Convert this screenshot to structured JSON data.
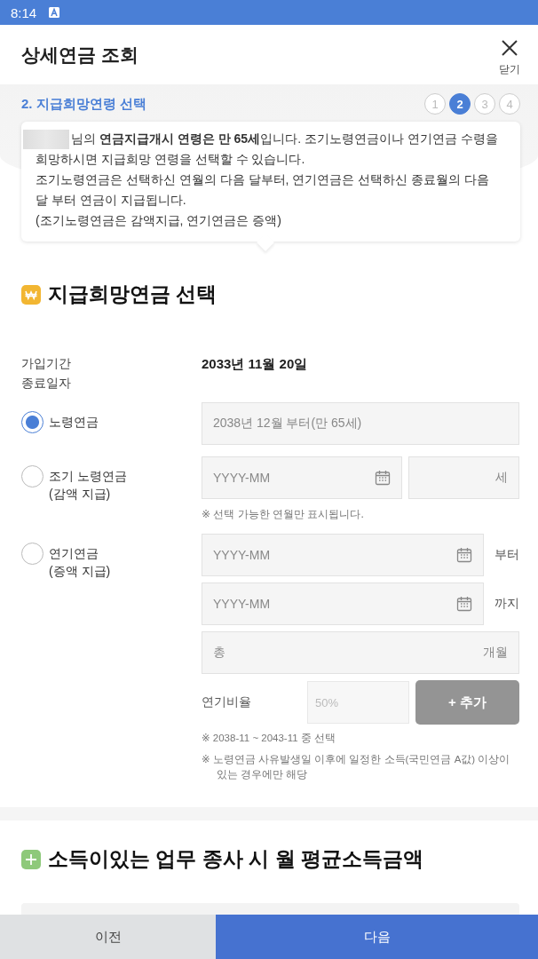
{
  "status_bar": {
    "time": "8:14"
  },
  "header": {
    "title": "상세연금 조회",
    "close_label": "닫기"
  },
  "steps": {
    "title": "2. 지급희망연령 선택",
    "items": [
      {
        "label": "1",
        "selected": false
      },
      {
        "label": "2",
        "selected": true
      },
      {
        "label": "3",
        "selected": false
      },
      {
        "label": "4",
        "selected": false
      }
    ]
  },
  "notice": {
    "paragraphs": [
      "님의 **연금지급개시 연령은 만 65세**입니다. 조기노령연금이나 연기연금 수령을 희망하시면 지급희망 연령을 선택할 수 있습니다.",
      "조기노령연금은 선택하신 연월의 다음 달부터, 연기연금은 선택하신 종료월의 다음 달 부터 연금이 지급됩니다.",
      "(조기노령연금은 감액지급, 연기연금은 증액)"
    ]
  },
  "section1": {
    "title": "지급희망연금 선택",
    "end_date_label": [
      "가입기간",
      "종료일자"
    ],
    "end_date": "2033년 11월 20일",
    "options": [
      {
        "kind": "fixed",
        "label": "노령연금",
        "selected": true,
        "value": "2038년 12월 부터(만 65세)"
      },
      {
        "kind": "early",
        "label": "조기 노령연금",
        "sublabel": "(감액 지급)",
        "selected": false,
        "date_placeholder": "YYYY-MM",
        "age_unit": "세",
        "note": "※ 선택 가능한 연월만 표시됩니다."
      },
      {
        "kind": "deferred",
        "label": "연기연금",
        "sublabel": "(증액 지급)",
        "selected": false,
        "from_placeholder": "YYYY-MM",
        "from_suffix": "부터",
        "to_placeholder": "YYYY-MM",
        "to_suffix": "까지",
        "total_prefix": "총",
        "total_unit": "개월",
        "ratio_label": "연기비율",
        "ratio_placeholder": "50%",
        "add_button": "+ 추가",
        "add_disabled": true,
        "notes": [
          "※ 2038-11 ~ 2043-11 중 선택",
          "※ 노령연금 사유발생일 이후에 일정한 소득(국민연금 A값) 이상이 있는 경우에만 해당"
        ]
      }
    ]
  },
  "section2": {
    "title": "소득이있는 업무 종사 시 월 평균소득금액"
  },
  "footer": {
    "prev": "이전",
    "next": "다음"
  }
}
